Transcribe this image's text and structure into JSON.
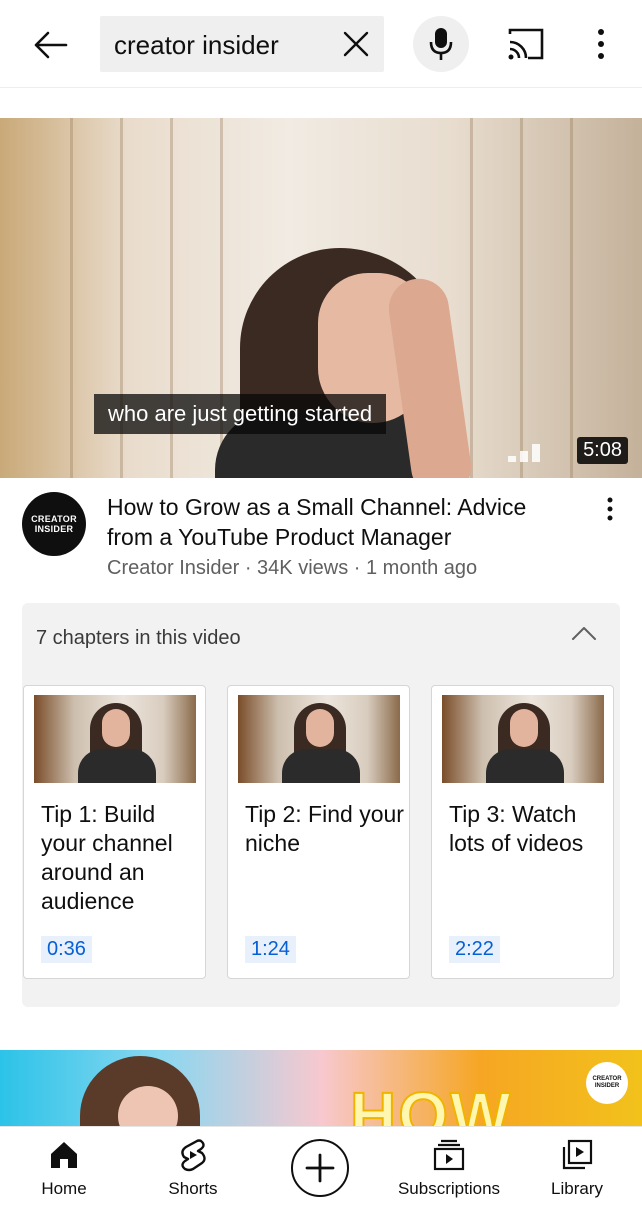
{
  "search": {
    "query": "creator insider"
  },
  "video": {
    "caption": "who are just getting started",
    "duration": "5:08",
    "title": "How to Grow as a Small Channel: Advice from a YouTube Product Manager",
    "meta": "Creator Insider · 34K views · 1 month ago",
    "channel_avatar_line1": "CREATOR",
    "channel_avatar_line2": "INSIDER"
  },
  "chapters": {
    "header": "7 chapters in this video",
    "items": [
      {
        "label": "Tip 1: Build your channel around an audience",
        "time": "0:36"
      },
      {
        "label": "Tip 2: Find your niche",
        "time": "1:24"
      },
      {
        "label": "Tip 3: Watch lots of videos",
        "time": "2:22"
      }
    ]
  },
  "next_video": {
    "headline": "HOW",
    "badge_line1": "CREATOR",
    "badge_line2": "INSIDER"
  },
  "bottom_nav": {
    "items": [
      {
        "label": "Home",
        "icon": "home-icon"
      },
      {
        "label": "Shorts",
        "icon": "shorts-icon"
      },
      {
        "label": "",
        "icon": "create-icon"
      },
      {
        "label": "Subscriptions",
        "icon": "subscriptions-icon"
      },
      {
        "label": "Library",
        "icon": "library-icon"
      }
    ]
  },
  "colors": {
    "accent_blue": "#065fd4",
    "text_primary": "#0f0f0f",
    "text_secondary": "#606060"
  }
}
